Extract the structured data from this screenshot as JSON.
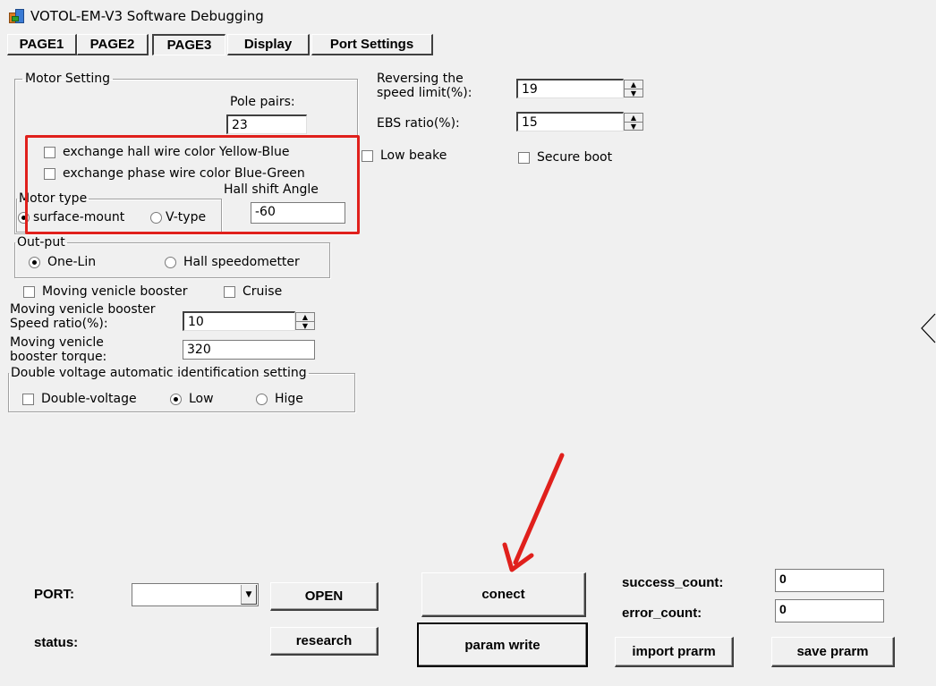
{
  "window": {
    "title": "VOTOL-EM-V3 Software Debugging",
    "icon": "app-icon"
  },
  "tabs": [
    {
      "label": "PAGE1"
    },
    {
      "label": "PAGE2"
    },
    {
      "label": "PAGE3",
      "active": true
    },
    {
      "label": "Display"
    },
    {
      "label": "Port Settings"
    }
  ],
  "motor_setting": {
    "legend": "Motor Setting",
    "pole_pairs_label": "Pole pairs:",
    "pole_pairs_value": "23",
    "exchange_hall_label": "exchange hall wire color Yellow-Blue",
    "exchange_phase_label": "exchange phase wire color Blue-Green",
    "motor_type_legend": "Motor type",
    "surface_mount_label": "surface-mount",
    "v_type_label": "V-type",
    "hall_shift_label": "Hall shift Angle",
    "hall_shift_value": "-60"
  },
  "right_settings": {
    "reversing_label_1": "Reversing the",
    "reversing_label_2": "speed limit(%):",
    "reversing_value": "19",
    "ebs_label": "EBS ratio(%):",
    "ebs_value": "15",
    "low_beake_label": "Low beake",
    "secure_boot_label": "Secure boot"
  },
  "output": {
    "legend": "Out-put",
    "one_lin_label": "One-Lin",
    "hall_speedometer_label": "Hall speedometter"
  },
  "booster": {
    "moving_booster_label": "Moving venicle booster",
    "cruise_label": "Cruise",
    "speed_ratio_label_1": "Moving venicle booster",
    "speed_ratio_label_2": "Speed ratio(%):",
    "speed_ratio_value": "10",
    "torque_label_1": "Moving venicle",
    "torque_label_2": "booster torque:",
    "torque_value": "320"
  },
  "double_voltage": {
    "legend": "Double voltage automatic identification setting",
    "double_voltage_label": "Double-voltage",
    "low_label": "Low",
    "high_label": "Hige"
  },
  "bottom": {
    "port_label": "PORT:",
    "port_value": "",
    "open_label": "OPEN",
    "status_label": "status:",
    "research_label": "research",
    "connect_label": "conect",
    "param_write_label": "param write",
    "success_count_label": "success_count:",
    "success_count_value": "0",
    "error_count_label": "error_count:",
    "error_count_value": "0",
    "import_label": "import prarm",
    "save_label": "save prarm"
  },
  "colors": {
    "annotation": "#e0201c",
    "background": "#f0f0f0"
  }
}
